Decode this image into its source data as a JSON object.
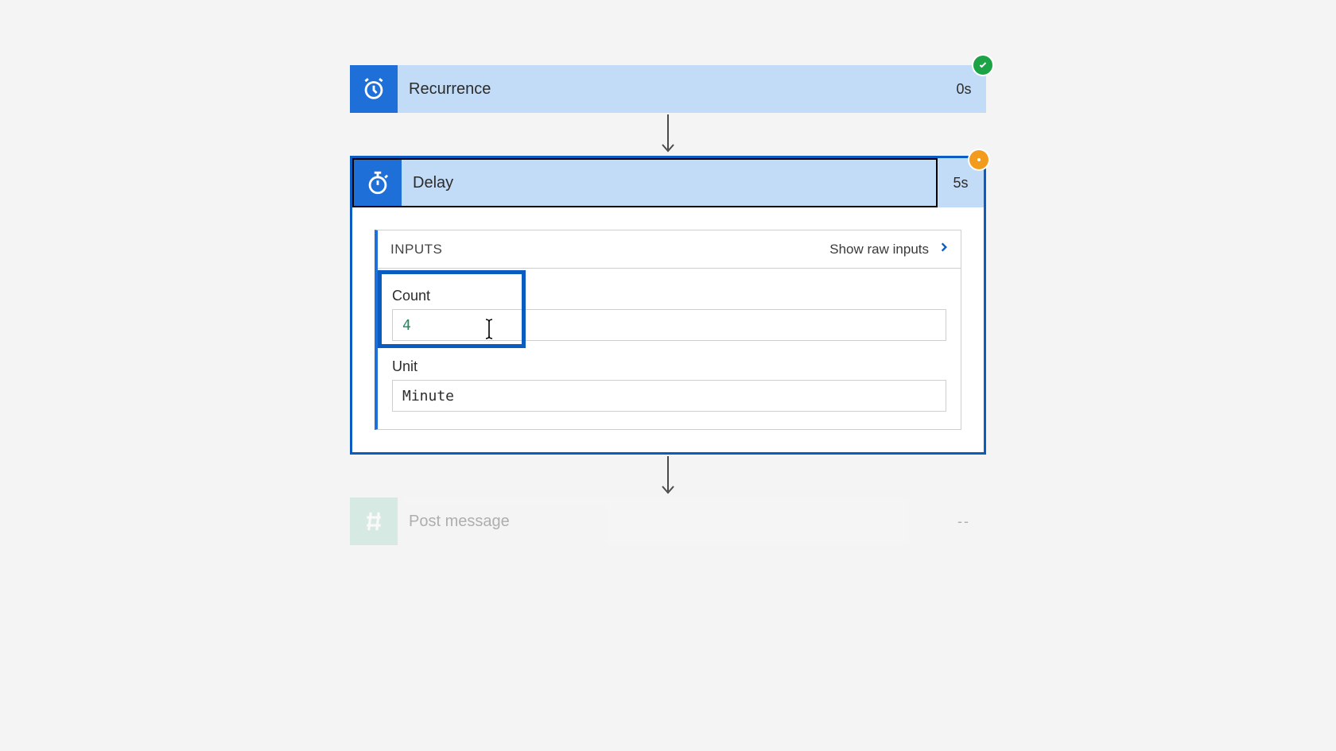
{
  "steps": {
    "recurrence": {
      "title": "Recurrence",
      "time": "0s",
      "status": "success"
    },
    "delay": {
      "title": "Delay",
      "time": "5s",
      "status": "warning",
      "inputs_label": "INPUTS",
      "show_raw_label": "Show raw inputs",
      "fields": {
        "count_label": "Count",
        "count_value": "4",
        "unit_label": "Unit",
        "unit_value": "Minute"
      }
    },
    "post": {
      "title": "Post message",
      "time": "--",
      "status": "pending"
    }
  }
}
